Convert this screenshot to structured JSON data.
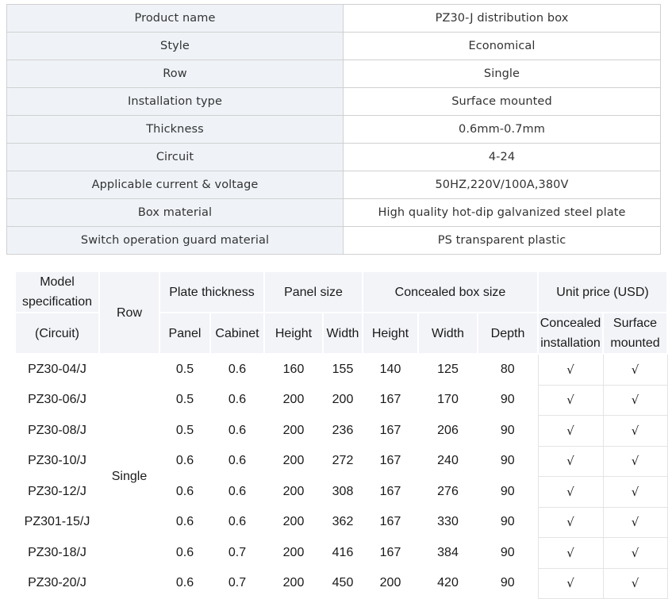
{
  "spec_table": {
    "rows": [
      {
        "label": "Product name",
        "value": "PZ30-J distribution box"
      },
      {
        "label": "Style",
        "value": "Economical"
      },
      {
        "label": "Row",
        "value": "Single"
      },
      {
        "label": "Installation type",
        "value": "Surface mounted"
      },
      {
        "label": "Thickness",
        "value": "0.6mm-0.7mm"
      },
      {
        "label": "Circuit",
        "value": "4-24"
      },
      {
        "label": "Applicable current & voltage",
        "value": "50HZ,220V/100A,380V"
      },
      {
        "label": "Box material",
        "value": "High quality hot-dip galvanized steel plate"
      },
      {
        "label": "Switch operation guard material",
        "value": "PS transparent plastic"
      }
    ]
  },
  "model_table": {
    "headers": {
      "model_top": "Model specification",
      "model_bottom": "(Circuit)",
      "row": "Row",
      "plate_thickness": "Plate thickness",
      "panel_size": "Panel size",
      "concealed_box_size": "Concealed box size",
      "unit_price": "Unit price (USD)",
      "panel": "Panel",
      "cabinet": "Cabinet",
      "panel_height": "Height",
      "panel_width": "Width",
      "box_height": "Height",
      "box_width": "Width",
      "box_depth": "Depth",
      "concealed_installation": "Concealed installation",
      "surface_mounted": "Surface mounted"
    },
    "row_value": "Single",
    "rows": [
      {
        "model": "PZ30-04/J",
        "panel": "0.5",
        "cabinet": "0.6",
        "panel_height": "160",
        "panel_width": "155",
        "box_height": "140",
        "box_width": "125",
        "box_depth": "80",
        "concealed": "√",
        "surface": "√"
      },
      {
        "model": "PZ30-06/J",
        "panel": "0.5",
        "cabinet": "0.6",
        "panel_height": "200",
        "panel_width": "200",
        "box_height": "167",
        "box_width": "170",
        "box_depth": "90",
        "concealed": "√",
        "surface": "√"
      },
      {
        "model": "PZ30-08/J",
        "panel": "0.5",
        "cabinet": "0.6",
        "panel_height": "200",
        "panel_width": "236",
        "box_height": "167",
        "box_width": "206",
        "box_depth": "90",
        "concealed": "√",
        "surface": "√"
      },
      {
        "model": "PZ30-10/J",
        "panel": "0.6",
        "cabinet": "0.6",
        "panel_height": "200",
        "panel_width": "272",
        "box_height": "167",
        "box_width": "240",
        "box_depth": "90",
        "concealed": "√",
        "surface": "√"
      },
      {
        "model": "PZ30-12/J",
        "panel": "0.6",
        "cabinet": "0.6",
        "panel_height": "200",
        "panel_width": "308",
        "box_height": "167",
        "box_width": "276",
        "box_depth": "90",
        "concealed": "√",
        "surface": "√"
      },
      {
        "model": "PZ301-15/J",
        "panel": "0.6",
        "cabinet": "0.6",
        "panel_height": "200",
        "panel_width": "362",
        "box_height": "167",
        "box_width": "330",
        "box_depth": "90",
        "concealed": "√",
        "surface": "√"
      },
      {
        "model": "PZ30-18/J",
        "panel": "0.6",
        "cabinet": "0.7",
        "panel_height": "200",
        "panel_width": "416",
        "box_height": "167",
        "box_width": "384",
        "box_depth": "90",
        "concealed": "√",
        "surface": "√"
      },
      {
        "model": "PZ30-20/J",
        "panel": "0.6",
        "cabinet": "0.7",
        "panel_height": "200",
        "panel_width": "450",
        "box_height": "200",
        "box_width": "420",
        "box_depth": "90",
        "concealed": "√",
        "surface": "√"
      }
    ]
  }
}
